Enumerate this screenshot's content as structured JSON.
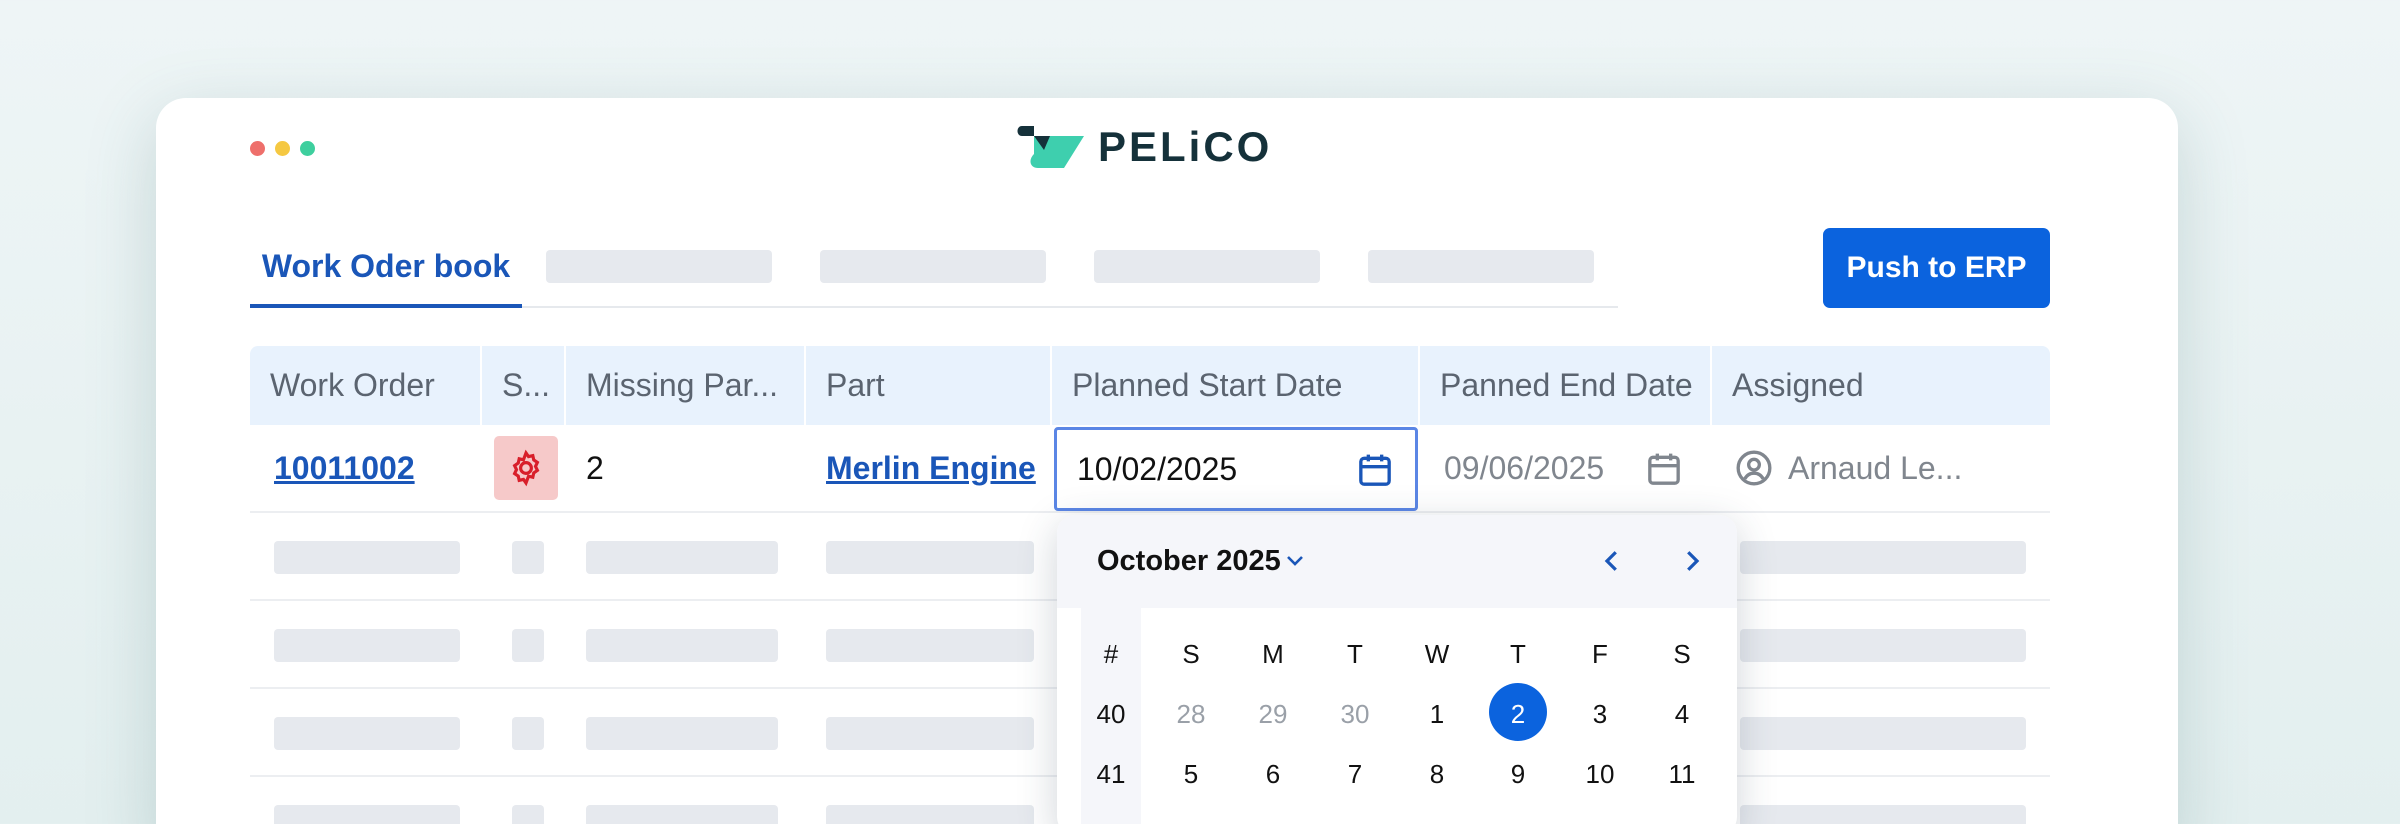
{
  "app": {
    "logo_text": "PELiCO"
  },
  "window_dots": {
    "colors": [
      "#ee6f6b",
      "#f5c842",
      "#3ecf9e"
    ]
  },
  "tabs": {
    "active_label": "Work Oder book"
  },
  "toolbar": {
    "push_label": "Push to ERP"
  },
  "table": {
    "columns": [
      "Work Order",
      "S...",
      "Missing Par...",
      "Part",
      "Planned Start Date",
      "Panned End Date",
      "Assigned"
    ],
    "row": {
      "work_order": "10011002",
      "status_icon": "gear-icon",
      "missing_parts": "2",
      "part": "Merlin Engine",
      "planned_start": "10/02/2025",
      "planned_end": "09/06/2025",
      "assigned": "Arnaud Le..."
    }
  },
  "calendar": {
    "month_label": "October 2025",
    "week_header": "#",
    "day_headers": [
      "S",
      "M",
      "T",
      "W",
      "T",
      "F",
      "S"
    ],
    "weeks": [
      {
        "num": "40",
        "days": [
          "28",
          "29",
          "30",
          "1",
          "2",
          "3",
          "4"
        ]
      },
      {
        "num": "41",
        "days": [
          "5",
          "6",
          "7",
          "8",
          "9",
          "10",
          "11"
        ]
      }
    ],
    "selected_day": "2",
    "colors": {
      "accent": "#0b63de",
      "muted": "#9aa0a8"
    }
  }
}
